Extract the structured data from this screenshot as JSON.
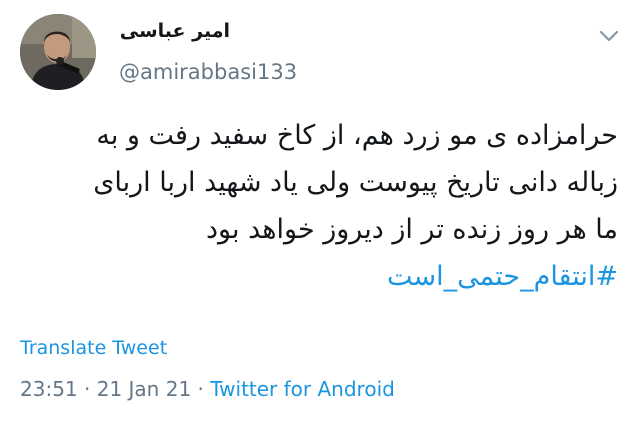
{
  "author": {
    "display_name": "امیر عباسی",
    "handle": "@amirabbasi133",
    "avatar_icon": "profile-photo"
  },
  "menu_icon": "chevron-down-icon",
  "tweet": {
    "lines": [
      "حرامزاده ی مو زرد هم، از کاخ سفید رفت و به",
      "زباله دانی تاریخ پیوست ولی یاد شهید اربا اربای",
      "ما هر روز زنده تر از دیروز خواهد بود"
    ],
    "hashtag": "#انتقام_حتمی_است"
  },
  "translate_label": "Translate Tweet",
  "meta": {
    "time": "23:51",
    "separator1": " · ",
    "date": "21 Jan 21",
    "separator2": " · ",
    "source": "Twitter for Android"
  },
  "colors": {
    "link": "#1b95e0",
    "secondary_text": "#657786",
    "primary_text": "#14171a"
  }
}
